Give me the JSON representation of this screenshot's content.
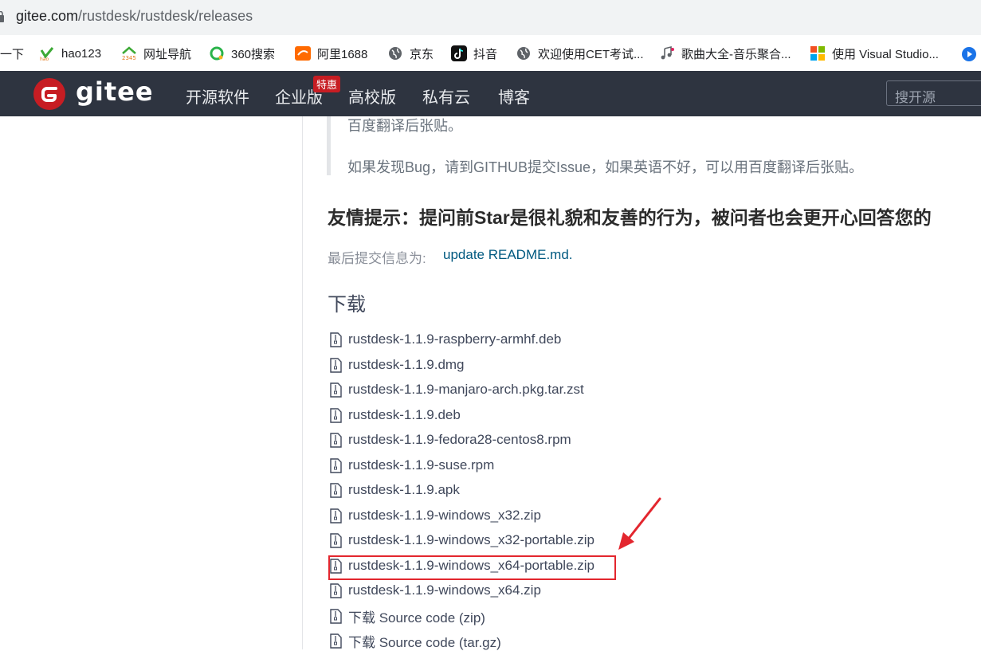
{
  "browser": {
    "url_host": "gitee.com",
    "url_path": "/rustdesk/rustdesk/releases",
    "bookmarks": [
      {
        "label": "一下",
        "icon": "none"
      },
      {
        "label": "hao123",
        "icon": "hao123-icon"
      },
      {
        "label": "网址导航",
        "icon": "2345-icon"
      },
      {
        "label": "360搜索",
        "icon": "360-search-icon"
      },
      {
        "label": "阿里1688",
        "icon": "alibaba-icon"
      },
      {
        "label": "京东",
        "icon": "globe-icon"
      },
      {
        "label": "抖音",
        "icon": "douyin-icon"
      },
      {
        "label": "欢迎使用CET考试...",
        "icon": "globe-icon"
      },
      {
        "label": "歌曲大全-音乐聚合...",
        "icon": "music-note-icon"
      },
      {
        "label": "使用 Visual Studio...",
        "icon": "microsoft-icon"
      }
    ]
  },
  "header": {
    "logo_text": "gitee",
    "nav": [
      "开源软件",
      "企业版",
      "高校版",
      "私有云",
      "博客"
    ],
    "badge": "特惠",
    "search_placeholder": "搜开源"
  },
  "content": {
    "quote_lines": [
      "百度翻译后张贴。",
      "如果发现Bug，请到GITHUB提交Issue，如果英语不好，可以用百度翻译后张贴。"
    ],
    "heading": "友情提示：提问前Star是很礼貌和友善的行为，被问者也会更开心回答您的",
    "commit_label": "最后提交信息为:",
    "commit_link": "update README.md.",
    "downloads_title": "下载",
    "files": [
      "rustdesk-1.1.9-raspberry-armhf.deb",
      "rustdesk-1.1.9.dmg",
      "rustdesk-1.1.9-manjaro-arch.pkg.tar.zst",
      "rustdesk-1.1.9.deb",
      "rustdesk-1.1.9-fedora28-centos8.rpm",
      "rustdesk-1.1.9-suse.rpm",
      "rustdesk-1.1.9.apk",
      "rustdesk-1.1.9-windows_x32.zip",
      "rustdesk-1.1.9-windows_x32-portable.zip",
      "rustdesk-1.1.9-windows_x64-portable.zip",
      "rustdesk-1.1.9-windows_x64.zip",
      "下载 Source code (zip)",
      "下载 Source code (tar.gz)"
    ],
    "highlighted_file": "rustdesk-1.1.9-windows_x64-portable.zip"
  },
  "colors": {
    "header_bg": "#2e3440",
    "brand_red": "#c71d23",
    "link": "#005980",
    "annotation_red": "#e3262e"
  }
}
